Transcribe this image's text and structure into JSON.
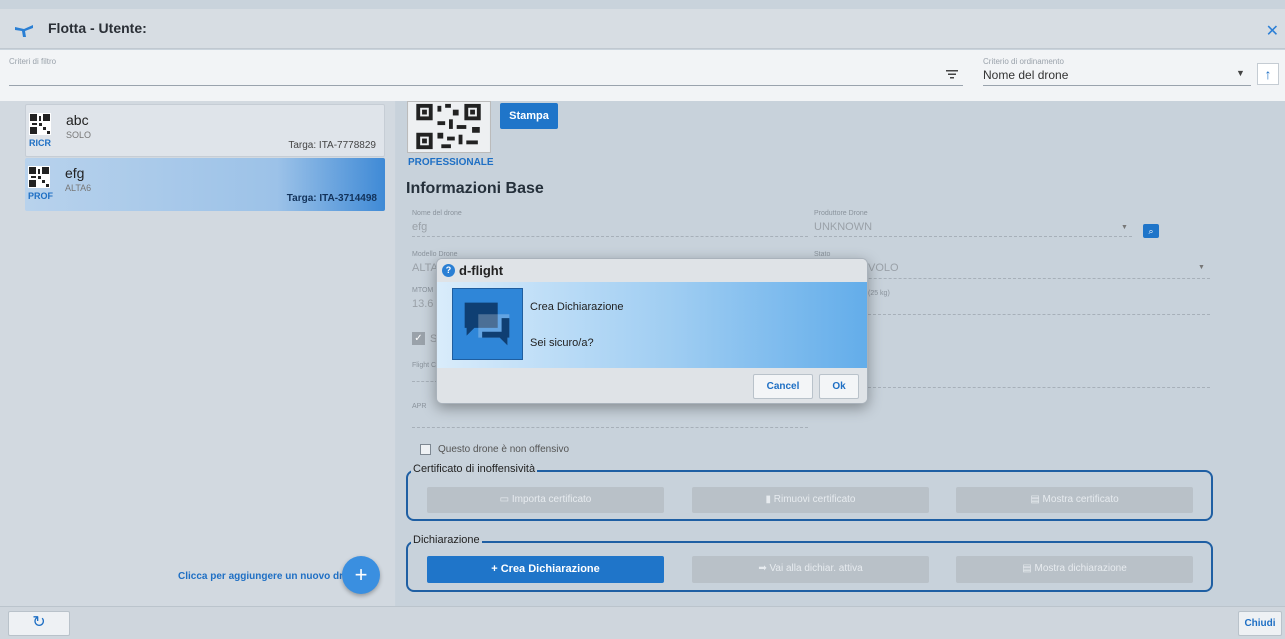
{
  "window": {
    "title": "Flotta - Utente:",
    "close_icon": "close-icon"
  },
  "filter": {
    "filter_label": "Criteri di filtro",
    "filter_value": "",
    "sort_label": "Criterio di ordinamento",
    "sort_value": "Nome del drone"
  },
  "drones": [
    {
      "type": "RICR",
      "name": "abc",
      "model": "SOLO",
      "plate": "Targa: ITA-7778829"
    },
    {
      "type": "PROF",
      "name": "efg",
      "model": "ALTA6",
      "plate": "Targa: ITA-3714498"
    }
  ],
  "add_drone_text": "Clicca per aggiungere un nuovo drone.",
  "detail": {
    "print_label": "Stampa",
    "category": "PROFESSIONALE",
    "section_title": "Informazioni Base",
    "fields": {
      "drone_name_label": "Nome del drone",
      "drone_name_value": "efg",
      "producer_label": "Produttore Drone",
      "producer_value": "UNKNOWN",
      "model_label": "Modello Drone",
      "model_value": "ALTA",
      "state_label": "Stato",
      "state_value": "VOLO",
      "mtom_label": "MTOM",
      "mtom_value": "13.6",
      "mtom_note": "(25 kg)",
      "s_label": "S",
      "flight_label": "Flight C",
      "apr_label": "APR"
    },
    "non_offensive_label": "Questo drone è non offensivo",
    "certificate": {
      "legend": "Certificato di inoffensività",
      "import": "Importa certificato",
      "remove": "Rimuovi certificato",
      "show": "Mostra certificato"
    },
    "declaration": {
      "legend": "Dichiarazione",
      "create": "+ Crea Dichiarazione",
      "go_active": "Vai alla dichiar. attiva",
      "show": "Mostra dichiarazione"
    }
  },
  "bottom": {
    "close_label": "Chiudi"
  },
  "dialog": {
    "title": "d-flight",
    "line1": "Crea Dichiarazione",
    "line2": "Sei sicuro/a?",
    "cancel": "Cancel",
    "ok": "Ok"
  },
  "colors": {
    "accent": "#1f75c9",
    "link": "#1e6fc4",
    "border_dark": "#1f5fa3"
  }
}
